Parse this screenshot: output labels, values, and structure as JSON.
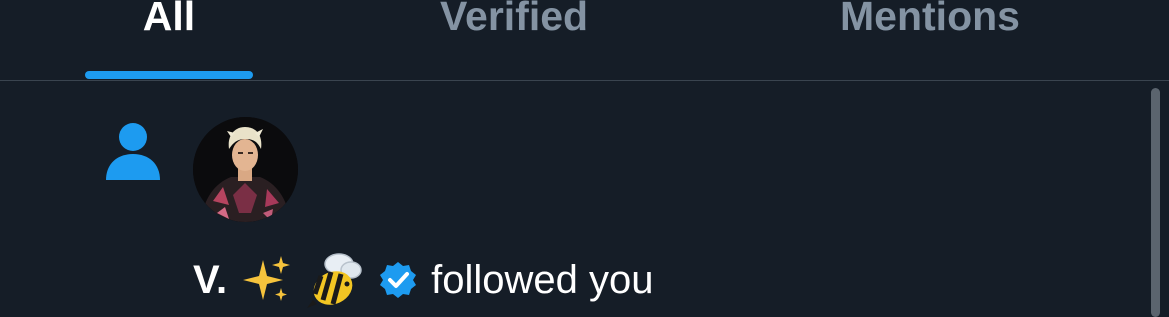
{
  "tabs": [
    {
      "label": "All",
      "active": true
    },
    {
      "label": "Verified",
      "active": false
    },
    {
      "label": "Mentions",
      "active": false
    }
  ],
  "notification": {
    "type_icon": "person-icon",
    "user_name": "V.",
    "name_emojis": [
      "sparkles-emoji",
      "bee-emoji"
    ],
    "verified": true,
    "action": "followed you"
  },
  "colors": {
    "background": "#151d27",
    "accent": "#1d9bf0",
    "tab_inactive": "#8493a3",
    "text": "#ffffff",
    "divider": "#3a444f"
  }
}
